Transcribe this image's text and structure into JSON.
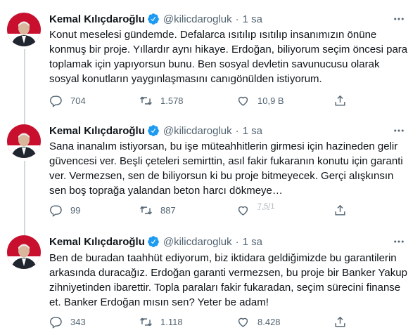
{
  "tweets": [
    {
      "author": "Kemal Kılıçdaroğlu",
      "handle": "@kilicdarogluk",
      "separator": "·",
      "time": "1 sa",
      "lines": [
        "Konut meselesi gündemde. Defalarca ısıtılıp ısıtılıp insanımızın önüne",
        "konmuş bir proje. Yıllardır aynı hikaye. Erdoğan, biliyorum seçim öncesi para",
        "toplamak için yapıyorsun bunu. Ben sosyal devletin savunucusu olarak",
        "sosyal konutların yaygınlaşmasını canıgönülden istiyorum."
      ],
      "replies": "704",
      "retweets": "1.578",
      "likes": "10,9 B",
      "views": ""
    },
    {
      "author": "Kemal Kılıçdaroğlu",
      "handle": "@kilicdarogluk",
      "separator": "·",
      "time": "1 sa",
      "lines": [
        "Sana inanalım istiyorsan, bu işe müteahhitlerin girmesi için hazineden gelir",
        "güvencesi ver. Beşli çeteleri semirttin, asıl fakir fukaranın konutu için garanti",
        "ver. Vermezsen, sen de biliyorsun ki bu proje bitmeyecek. Gerçi alışkınsın",
        "sen boş toprağa yalandan beton harcı dökmeye…"
      ],
      "replies": "99",
      "retweets": "887",
      "likes": "7.5/1",
      "likes_sub": "‾ ‾ ‾",
      "views": ""
    },
    {
      "author": "Kemal Kılıçdaroğlu",
      "handle": "@kilicdarogluk",
      "separator": "·",
      "time": "1 sa",
      "lines": [
        "Ben de buradan taahhüt ediyorum, biz iktidara geldiğimizde bu garantilerin",
        "arkasında duracağız. Erdoğan garanti vermezsen, bu proje bir Banker Yakup",
        "zihniyetinden ibarettir. Topla paraları fakir fukaradan, seçim sürecini finanse",
        "et. Banker Erdoğan mısın sen? Yeter be adam!"
      ],
      "replies": "343",
      "retweets": "1.118",
      "likes": "8.428",
      "views": ""
    }
  ],
  "colors": {
    "text": "#0f1419",
    "muted": "#536471",
    "verified": "#1d9bf0",
    "thread_line": "#cfd9de",
    "divider": "#eff3f4"
  },
  "icons": [
    "verified-badge-icon",
    "more-icon",
    "reply-icon",
    "retweet-icon",
    "like-icon",
    "share-icon"
  ]
}
